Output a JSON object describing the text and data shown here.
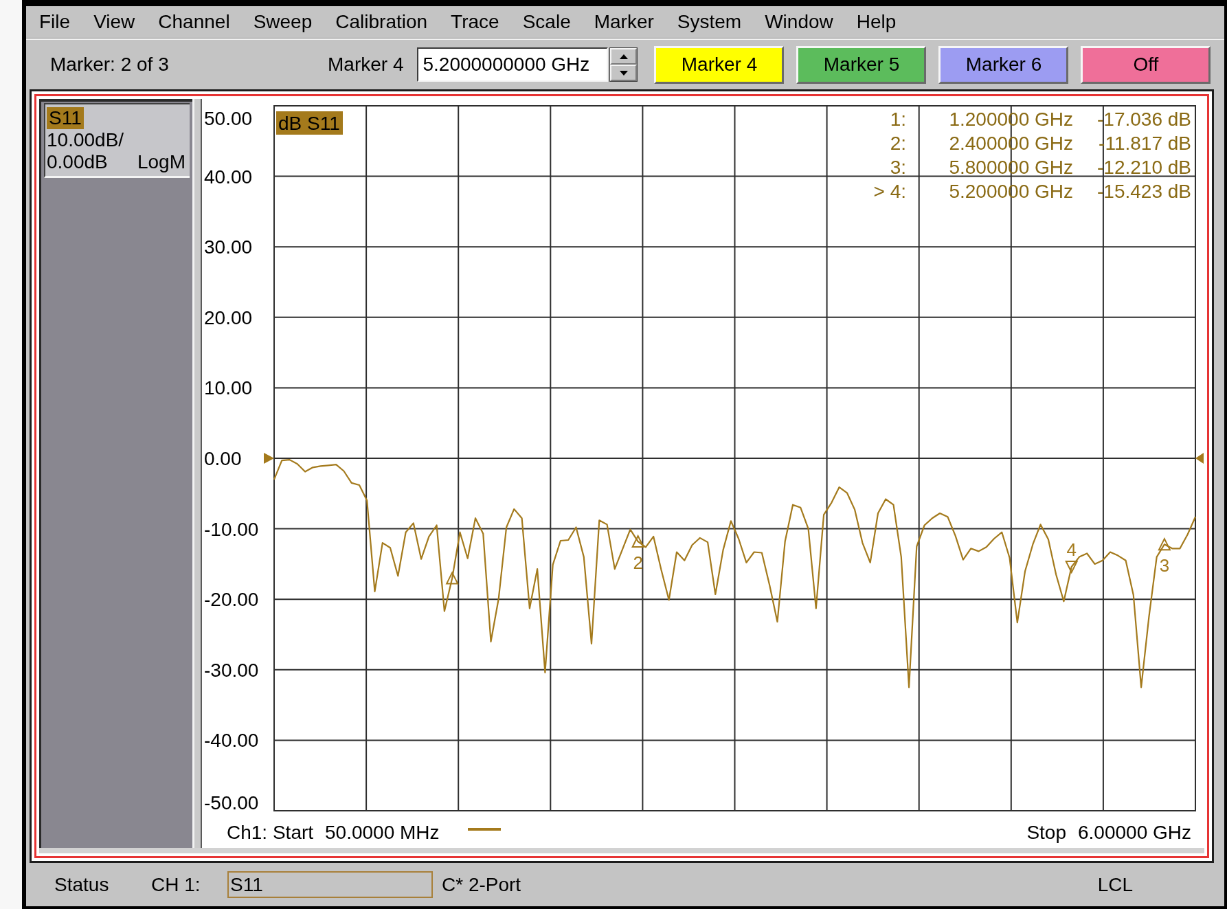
{
  "menu": [
    {
      "label": "File"
    },
    {
      "label": "View"
    },
    {
      "label": "Channel"
    },
    {
      "label": "Sweep"
    },
    {
      "label": "Calibration"
    },
    {
      "label": "Trace"
    },
    {
      "label": "Scale"
    },
    {
      "label": "Marker"
    },
    {
      "label": "System"
    },
    {
      "label": "Window"
    },
    {
      "label": "Help"
    }
  ],
  "toolbar": {
    "active_marker": "Marker: 2 of 3",
    "marker_label": "Marker 4",
    "marker_value": "5.2000000000 GHz",
    "buttons": [
      {
        "label": "Marker 4",
        "color": "#ffff00"
      },
      {
        "label": "Marker 5",
        "color": "#5cbc5c"
      },
      {
        "label": "Marker 6",
        "color": "#9c9cf2"
      },
      {
        "label": "Off",
        "color": "#ef6f99"
      }
    ]
  },
  "channel_info": {
    "trace": "S11",
    "scale": "10.00dB/",
    "reference": "0.00dB",
    "format": "LogM"
  },
  "plot": {
    "marker_readout": [
      {
        "label": "1:",
        "frequency": "1.200000 GHz",
        "value": "-17.036 dB",
        "selected": false
      },
      {
        "label": "2:",
        "frequency": "2.400000 GHz",
        "value": "-11.817 dB",
        "selected": false
      },
      {
        "label": "3:",
        "frequency": "5.800000 GHz",
        "value": "-12.210 dB",
        "selected": false
      },
      {
        "label": "> 4:",
        "frequency": "5.200000 GHz",
        "value": "-15.423 dB",
        "selected": true
      }
    ],
    "stimulus": {
      "start_label": "Ch1: Start",
      "start": "50.0000 MHz",
      "stop_label": "Stop",
      "stop": "6.00000 GHz"
    },
    "chart_data": {
      "type": "line",
      "title": "dB S11",
      "grid": true,
      "ylim": [
        -50,
        50
      ],
      "yticks": [
        {
          "value": 50,
          "label": "50.00"
        },
        {
          "value": 40,
          "label": "40.00"
        },
        {
          "value": 30,
          "label": "30.00"
        },
        {
          "value": 20,
          "label": "20.00"
        },
        {
          "value": 10,
          "label": "10.00"
        },
        {
          "value": 0,
          "label": "0.00"
        },
        {
          "value": -10,
          "label": "-10.00"
        },
        {
          "value": -20,
          "label": "-20.00"
        },
        {
          "value": -30,
          "label": "-30.00"
        },
        {
          "value": -40,
          "label": "-40.00"
        },
        {
          "value": -50,
          "label": "-50.00"
        }
      ],
      "categories": [
        null,
        null,
        null,
        null,
        null,
        null,
        null,
        null,
        null,
        null,
        null,
        null,
        null,
        null,
        null,
        null,
        null,
        null,
        null,
        null,
        null,
        null,
        null,
        null,
        null,
        null,
        null,
        null,
        null,
        null,
        null,
        null,
        null,
        null,
        null,
        null,
        null,
        null,
        null,
        null,
        null,
        null,
        null,
        null,
        null,
        null,
        null,
        null,
        null,
        null,
        null,
        null,
        null,
        null,
        null,
        null,
        null,
        null,
        null,
        null,
        null,
        null,
        null,
        null,
        null,
        null,
        null,
        null,
        null,
        null,
        null,
        null,
        null,
        null,
        null,
        null,
        null,
        null,
        null,
        null,
        null,
        null,
        null,
        null,
        null,
        null,
        null,
        null,
        null,
        null,
        null,
        null,
        null,
        null,
        null,
        null,
        null,
        null,
        null,
        null,
        null,
        null,
        null,
        null,
        null,
        null,
        null,
        null,
        null,
        null,
        null,
        null,
        null,
        null,
        null,
        null,
        null,
        null,
        null,
        null
      ],
      "series": [
        {
          "color": "#a47a1c",
          "values": [
            -3.0,
            -0.3,
            -0.2,
            -0.8,
            -1.9,
            -1.3,
            -1.1,
            -1.0,
            -0.9,
            -1.8,
            -3.5,
            -3.8,
            -6.0,
            -18.9,
            -12.0,
            -12.7,
            -16.7,
            -10.5,
            -9.2,
            -14.3,
            -11.1,
            -9.5,
            -21.7,
            -17.0,
            -10.5,
            -14.2,
            -8.5,
            -10.7,
            -26.0,
            -19.9,
            -9.8,
            -7.2,
            -8.5,
            -21.3,
            -15.7,
            -30.4,
            -15.1,
            -11.7,
            -11.6,
            -9.8,
            -14.0,
            -26.3,
            -8.8,
            -9.4,
            -15.7,
            -12.9,
            -10.1,
            -11.8,
            -12.6,
            -11.1,
            -15.8,
            -20.1,
            -13.3,
            -14.5,
            -12.3,
            -11.3,
            -11.9,
            -19.3,
            -13.0,
            -8.9,
            -11.4,
            -14.8,
            -13.3,
            -13.4,
            -18.0,
            -23.2,
            -11.8,
            -6.6,
            -7.0,
            -10.0,
            -21.3,
            -8.0,
            -6.3,
            -4.1,
            -4.9,
            -7.3,
            -12.0,
            -14.8,
            -7.8,
            -5.8,
            -6.6,
            -14.0,
            -32.5,
            -12.5,
            -9.5,
            -8.5,
            -7.8,
            -8.3,
            -11.0,
            -14.4,
            -12.8,
            -13.2,
            -12.6,
            -11.4,
            -10.5,
            -14.1,
            -23.3,
            -16.0,
            -12.2,
            -9.4,
            -11.5,
            -16.5,
            -20.3,
            -15.4,
            -14.0,
            -13.5,
            -15.0,
            -14.5,
            -13.3,
            -13.8,
            -14.5,
            -19.4,
            -32.5,
            -22.5,
            -14.0,
            -12.2,
            -12.8,
            -12.8,
            -10.8,
            -8.3
          ]
        },
        {
          "color": "#a47a1c",
          "marker": "triangle",
          "values": [
            null,
            null,
            null,
            null,
            null,
            null,
            null,
            null,
            null,
            null,
            null,
            null,
            null,
            null,
            null,
            null,
            null,
            null,
            null,
            null,
            null,
            null,
            null,
            -17.0,
            null,
            null,
            null,
            null,
            null,
            null,
            null,
            null,
            null,
            null,
            null,
            null,
            null,
            null,
            null,
            null,
            null,
            null,
            null,
            null,
            null,
            null,
            null,
            null,
            null,
            null,
            null,
            null,
            null,
            null,
            null,
            null,
            null,
            null,
            null,
            null,
            null,
            null,
            null,
            null,
            null,
            null,
            null,
            null,
            null,
            null,
            null,
            null,
            null,
            null,
            null,
            null,
            null,
            null,
            null,
            null,
            null,
            null,
            null,
            null,
            null,
            null,
            null,
            null,
            null,
            null,
            null,
            null,
            null,
            null,
            null,
            null,
            null,
            null,
            null,
            null,
            null,
            null,
            null,
            null,
            null,
            null,
            null,
            null,
            null,
            null,
            null,
            null,
            null,
            null,
            null,
            null,
            null,
            null,
            null,
            null
          ]
        },
        {
          "name": "2",
          "color": "#a47a1c",
          "marker": "triangle",
          "values": [
            null,
            null,
            null,
            null,
            null,
            null,
            null,
            null,
            null,
            null,
            null,
            null,
            null,
            null,
            null,
            null,
            null,
            null,
            null,
            null,
            null,
            null,
            null,
            null,
            null,
            null,
            null,
            null,
            null,
            null,
            null,
            null,
            null,
            null,
            null,
            null,
            null,
            null,
            null,
            null,
            null,
            null,
            null,
            null,
            null,
            null,
            null,
            -11.8,
            null,
            null,
            null,
            null,
            null,
            null,
            null,
            null,
            null,
            null,
            null,
            null,
            null,
            null,
            null,
            null,
            null,
            null,
            null,
            null,
            null,
            null,
            null,
            null,
            null,
            null,
            null,
            null,
            null,
            null,
            null,
            null,
            null,
            null,
            null,
            null,
            null,
            null,
            null,
            null,
            null,
            null,
            null,
            null,
            null,
            null,
            null,
            null,
            null,
            null,
            null,
            null,
            null,
            null,
            null,
            null,
            null,
            null,
            null,
            null,
            null,
            null,
            null,
            null,
            null,
            null,
            null,
            null,
            null,
            null,
            null,
            null
          ]
        },
        {
          "name": "3",
          "color": "#a47a1c",
          "marker": "triangle",
          "values": [
            null,
            null,
            null,
            null,
            null,
            null,
            null,
            null,
            null,
            null,
            null,
            null,
            null,
            null,
            null,
            null,
            null,
            null,
            null,
            null,
            null,
            null,
            null,
            null,
            null,
            null,
            null,
            null,
            null,
            null,
            null,
            null,
            null,
            null,
            null,
            null,
            null,
            null,
            null,
            null,
            null,
            null,
            null,
            null,
            null,
            null,
            null,
            null,
            null,
            null,
            null,
            null,
            null,
            null,
            null,
            null,
            null,
            null,
            null,
            null,
            null,
            null,
            null,
            null,
            null,
            null,
            null,
            null,
            null,
            null,
            null,
            null,
            null,
            null,
            null,
            null,
            null,
            null,
            null,
            null,
            null,
            null,
            null,
            null,
            null,
            null,
            null,
            null,
            null,
            null,
            null,
            null,
            null,
            null,
            null,
            null,
            null,
            null,
            null,
            null,
            null,
            null,
            null,
            null,
            null,
            null,
            null,
            null,
            null,
            null,
            null,
            null,
            null,
            null,
            null,
            -12.2,
            null,
            null,
            null,
            null
          ]
        },
        {
          "name": "4",
          "color": "#a47a1c",
          "marker": "triangle",
          "values": [
            null,
            null,
            null,
            null,
            null,
            null,
            null,
            null,
            null,
            null,
            null,
            null,
            null,
            null,
            null,
            null,
            null,
            null,
            null,
            null,
            null,
            null,
            null,
            null,
            null,
            null,
            null,
            null,
            null,
            null,
            null,
            null,
            null,
            null,
            null,
            null,
            null,
            null,
            null,
            null,
            null,
            null,
            null,
            null,
            null,
            null,
            null,
            null,
            null,
            null,
            null,
            null,
            null,
            null,
            null,
            null,
            null,
            null,
            null,
            null,
            null,
            null,
            null,
            null,
            null,
            null,
            null,
            null,
            null,
            null,
            null,
            null,
            null,
            null,
            null,
            null,
            null,
            null,
            null,
            null,
            null,
            null,
            null,
            null,
            null,
            null,
            null,
            null,
            null,
            null,
            null,
            null,
            null,
            null,
            null,
            null,
            null,
            null,
            null,
            null,
            null,
            null,
            null,
            -15.4,
            null,
            null,
            null,
            null,
            null,
            null,
            null,
            null,
            null,
            null,
            null,
            null,
            null,
            null,
            null,
            null
          ]
        }
      ]
    }
  },
  "status_bar": {
    "label": "Status",
    "channel": "CH 1:",
    "measurement": "S11",
    "calibration": "C* 2-Port",
    "control": "LCL"
  }
}
